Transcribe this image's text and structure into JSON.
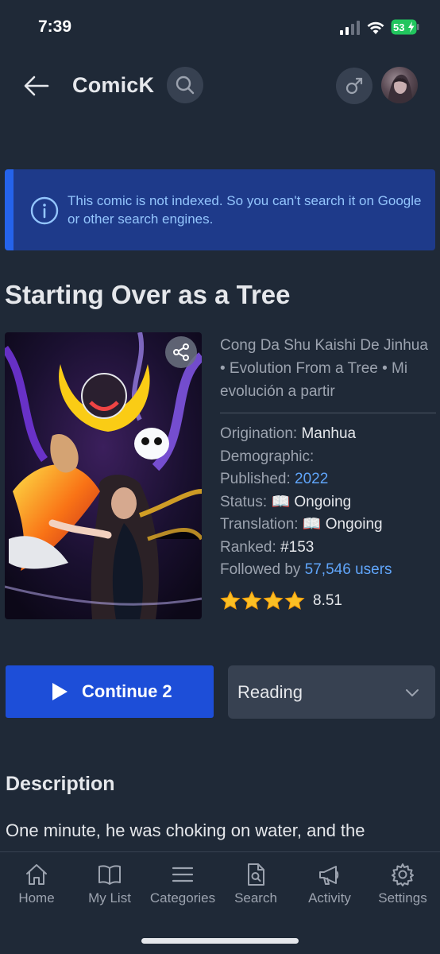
{
  "status_bar": {
    "time": "7:39",
    "battery": "53"
  },
  "header": {
    "title": "ComicK"
  },
  "banner": {
    "text": "This comic is not indexed. So you can't search it on Google or other search engines."
  },
  "comic": {
    "title": "Starting Over as a Tree",
    "alt_titles": "Cong Da Shu Kaishi De Jinhua • Evolution From a Tree • Mi evolución a partir",
    "origination_label": "Origination:",
    "origination_value": "Manhua",
    "demographic_label": "Demographic:",
    "published_label": "Published:",
    "published_value": "2022",
    "status_label": "Status:",
    "status_value": "📖 Ongoing",
    "translation_label": "Translation:",
    "translation_value": "📖 Ongoing",
    "ranked_label": "Ranked:",
    "ranked_value": "#153",
    "followed_label": "Followed by",
    "followed_value": "57,546 users",
    "rating_value": "8.51",
    "stars": 4
  },
  "actions": {
    "continue_label": "Continue 2",
    "reading_value": "Reading"
  },
  "description": {
    "heading": "Description",
    "text": "One minute, he was choking on water, and the"
  },
  "bottom_nav": [
    {
      "label": "Home",
      "icon": "home-icon"
    },
    {
      "label": "My List",
      "icon": "book-open-icon"
    },
    {
      "label": "Categories",
      "icon": "list-icon"
    },
    {
      "label": "Search",
      "icon": "document-search-icon"
    },
    {
      "label": "Activity",
      "icon": "megaphone-icon"
    },
    {
      "label": "Settings",
      "icon": "gear-icon"
    }
  ],
  "colors": {
    "background": "#1f2937",
    "accent": "#1d4ed8",
    "banner_bg": "#1e3a8a",
    "link": "#60a5fa",
    "star": "#fbbf24"
  }
}
